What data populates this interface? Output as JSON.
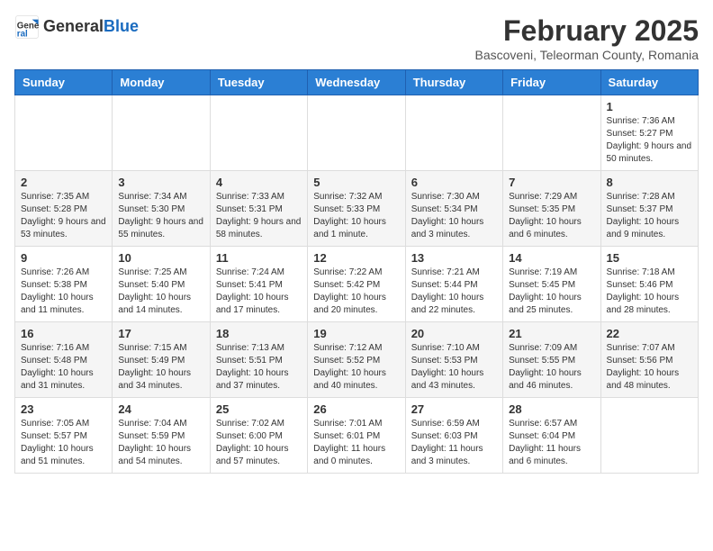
{
  "header": {
    "logo_line1": "General",
    "logo_line2": "Blue",
    "month_title": "February 2025",
    "subtitle": "Bascoveni, Teleorman County, Romania"
  },
  "weekdays": [
    "Sunday",
    "Monday",
    "Tuesday",
    "Wednesday",
    "Thursday",
    "Friday",
    "Saturday"
  ],
  "weeks": [
    [
      {
        "day": "",
        "info": ""
      },
      {
        "day": "",
        "info": ""
      },
      {
        "day": "",
        "info": ""
      },
      {
        "day": "",
        "info": ""
      },
      {
        "day": "",
        "info": ""
      },
      {
        "day": "",
        "info": ""
      },
      {
        "day": "1",
        "info": "Sunrise: 7:36 AM\nSunset: 5:27 PM\nDaylight: 9 hours and 50 minutes."
      }
    ],
    [
      {
        "day": "2",
        "info": "Sunrise: 7:35 AM\nSunset: 5:28 PM\nDaylight: 9 hours and 53 minutes."
      },
      {
        "day": "3",
        "info": "Sunrise: 7:34 AM\nSunset: 5:30 PM\nDaylight: 9 hours and 55 minutes."
      },
      {
        "day": "4",
        "info": "Sunrise: 7:33 AM\nSunset: 5:31 PM\nDaylight: 9 hours and 58 minutes."
      },
      {
        "day": "5",
        "info": "Sunrise: 7:32 AM\nSunset: 5:33 PM\nDaylight: 10 hours and 1 minute."
      },
      {
        "day": "6",
        "info": "Sunrise: 7:30 AM\nSunset: 5:34 PM\nDaylight: 10 hours and 3 minutes."
      },
      {
        "day": "7",
        "info": "Sunrise: 7:29 AM\nSunset: 5:35 PM\nDaylight: 10 hours and 6 minutes."
      },
      {
        "day": "8",
        "info": "Sunrise: 7:28 AM\nSunset: 5:37 PM\nDaylight: 10 hours and 9 minutes."
      }
    ],
    [
      {
        "day": "9",
        "info": "Sunrise: 7:26 AM\nSunset: 5:38 PM\nDaylight: 10 hours and 11 minutes."
      },
      {
        "day": "10",
        "info": "Sunrise: 7:25 AM\nSunset: 5:40 PM\nDaylight: 10 hours and 14 minutes."
      },
      {
        "day": "11",
        "info": "Sunrise: 7:24 AM\nSunset: 5:41 PM\nDaylight: 10 hours and 17 minutes."
      },
      {
        "day": "12",
        "info": "Sunrise: 7:22 AM\nSunset: 5:42 PM\nDaylight: 10 hours and 20 minutes."
      },
      {
        "day": "13",
        "info": "Sunrise: 7:21 AM\nSunset: 5:44 PM\nDaylight: 10 hours and 22 minutes."
      },
      {
        "day": "14",
        "info": "Sunrise: 7:19 AM\nSunset: 5:45 PM\nDaylight: 10 hours and 25 minutes."
      },
      {
        "day": "15",
        "info": "Sunrise: 7:18 AM\nSunset: 5:46 PM\nDaylight: 10 hours and 28 minutes."
      }
    ],
    [
      {
        "day": "16",
        "info": "Sunrise: 7:16 AM\nSunset: 5:48 PM\nDaylight: 10 hours and 31 minutes."
      },
      {
        "day": "17",
        "info": "Sunrise: 7:15 AM\nSunset: 5:49 PM\nDaylight: 10 hours and 34 minutes."
      },
      {
        "day": "18",
        "info": "Sunrise: 7:13 AM\nSunset: 5:51 PM\nDaylight: 10 hours and 37 minutes."
      },
      {
        "day": "19",
        "info": "Sunrise: 7:12 AM\nSunset: 5:52 PM\nDaylight: 10 hours and 40 minutes."
      },
      {
        "day": "20",
        "info": "Sunrise: 7:10 AM\nSunset: 5:53 PM\nDaylight: 10 hours and 43 minutes."
      },
      {
        "day": "21",
        "info": "Sunrise: 7:09 AM\nSunset: 5:55 PM\nDaylight: 10 hours and 46 minutes."
      },
      {
        "day": "22",
        "info": "Sunrise: 7:07 AM\nSunset: 5:56 PM\nDaylight: 10 hours and 48 minutes."
      }
    ],
    [
      {
        "day": "23",
        "info": "Sunrise: 7:05 AM\nSunset: 5:57 PM\nDaylight: 10 hours and 51 minutes."
      },
      {
        "day": "24",
        "info": "Sunrise: 7:04 AM\nSunset: 5:59 PM\nDaylight: 10 hours and 54 minutes."
      },
      {
        "day": "25",
        "info": "Sunrise: 7:02 AM\nSunset: 6:00 PM\nDaylight: 10 hours and 57 minutes."
      },
      {
        "day": "26",
        "info": "Sunrise: 7:01 AM\nSunset: 6:01 PM\nDaylight: 11 hours and 0 minutes."
      },
      {
        "day": "27",
        "info": "Sunrise: 6:59 AM\nSunset: 6:03 PM\nDaylight: 11 hours and 3 minutes."
      },
      {
        "day": "28",
        "info": "Sunrise: 6:57 AM\nSunset: 6:04 PM\nDaylight: 11 hours and 6 minutes."
      },
      {
        "day": "",
        "info": ""
      }
    ]
  ]
}
